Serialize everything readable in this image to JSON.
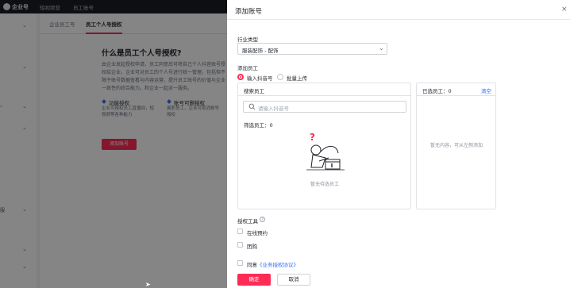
{
  "app": {
    "logo": "企业号",
    "topnav": [
      "短视频营",
      "员工账号"
    ]
  },
  "background": {
    "subtabs": [
      "企业员工号",
      "员工个人号授权"
    ],
    "title": "什么是员工个人号授权?",
    "paragraph": "由企业发起授权申请，员工同意后可将自己个人抖音账号授权给企业，企业可对员工的个人号进行统一管理，包括但不限于账号数据查看与内容运营，提升员工账号的价值与企业一致性的综合能力。和企业一起对一服务。",
    "feature1": {
      "title": "功能授权",
      "desc": "企业可授权员工直播间，短视频等各种能力"
    },
    "feature2": {
      "title": "账号可删授权",
      "desc": "离职员工，企业可取消账号授权"
    },
    "cta": "添加账号",
    "sidebar_label": "服"
  },
  "drawer": {
    "title": "添加账号",
    "close": "×",
    "industry_label": "行业类型",
    "industry_value": "服装配饰 - 配饰",
    "add_label": "添加员工",
    "radio_douyin": "输入抖音号",
    "radio_batch": "批量上传",
    "search_panel": {
      "header": "搜索员工",
      "placeholder": "请输入抖音号",
      "filtered": "筛选员工：0",
      "empty": "暂无待选员工"
    },
    "selected_panel": {
      "header": "已选员工：0",
      "clear": "清空",
      "empty": "暂无内容，可从左侧添加"
    },
    "tools_label": "授权工具",
    "help": "?",
    "tool1": "在线预约",
    "tool2": "团购",
    "agree_prefix": "同意",
    "agree_link": "《业务授权协议》",
    "confirm": "确定",
    "cancel": "取消"
  }
}
